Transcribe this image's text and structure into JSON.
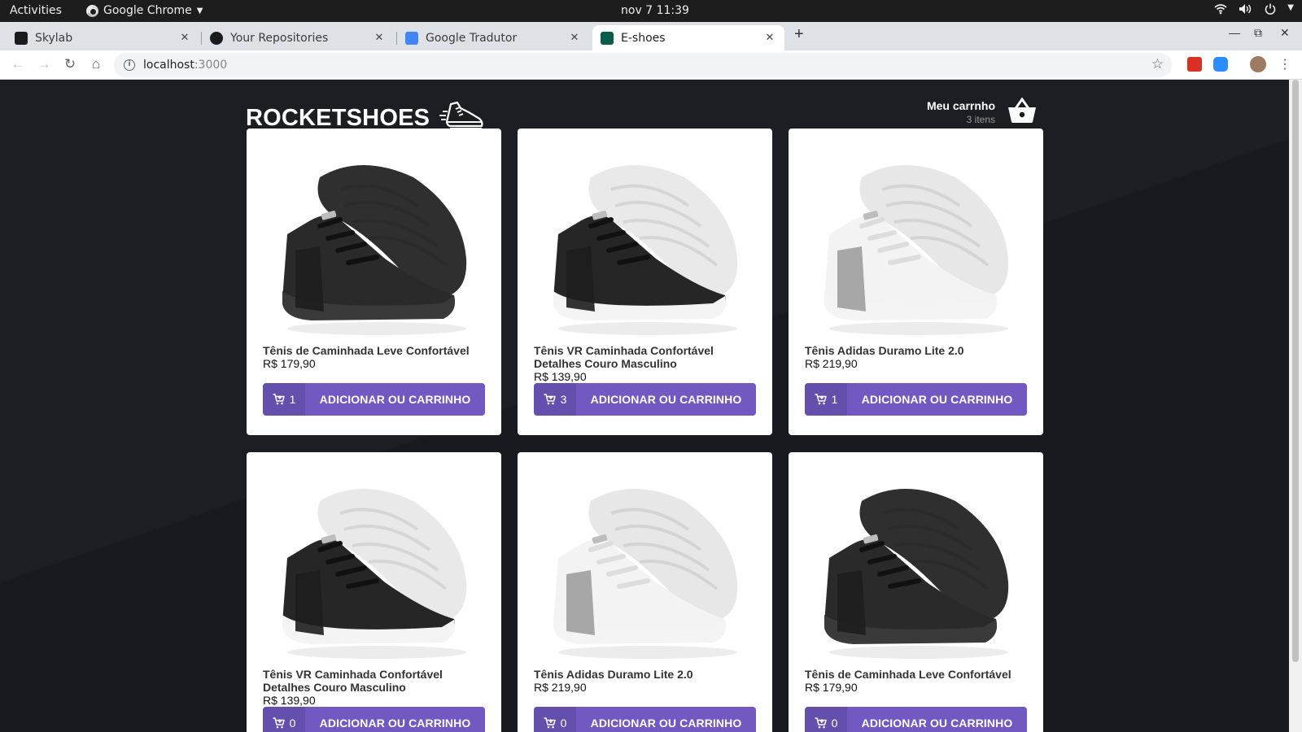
{
  "os": {
    "activities": "Activities",
    "app_name": "Google Chrome",
    "clock": "nov 7  11:39"
  },
  "browser": {
    "tabs": [
      {
        "title": "Skylab",
        "icon": "skylab-icon",
        "active": false
      },
      {
        "title": "Your Repositories",
        "icon": "github-icon",
        "active": false
      },
      {
        "title": "Google Tradutor",
        "icon": "google-translate-icon",
        "active": false
      },
      {
        "title": "E-shoes",
        "icon": "react-icon",
        "active": true
      }
    ],
    "url_host": "localhost",
    "url_port": ":3000"
  },
  "header": {
    "logo_text": "ROCKETSHOES",
    "cart_label": "Meu carrnho",
    "cart_count": "3 itens"
  },
  "products": [
    {
      "name": "Tênis de Caminhada Leve Confortável",
      "price": "R$ 179,90",
      "qty": "1",
      "button": "ADICIONAR OU CARRINHO",
      "shoe": "black"
    },
    {
      "name": "Tênis VR Caminhada Confortável Detalhes Couro Masculino",
      "price": "R$ 139,90",
      "qty": "3",
      "button": "ADICIONAR OU CARRINHO",
      "shoe": "black-white"
    },
    {
      "name": "Tênis Adidas Duramo Lite 2.0",
      "price": "R$ 219,90",
      "qty": "1",
      "button": "ADICIONAR OU CARRINHO",
      "shoe": "white-grey"
    },
    {
      "name": "Tênis VR Caminhada Confortável Detalhes Couro Masculino",
      "price": "R$ 139,90",
      "qty": "0",
      "button": "ADICIONAR OU CARRINHO",
      "shoe": "black-white"
    },
    {
      "name": "Tênis Adidas Duramo Lite 2.0",
      "price": "R$ 219,90",
      "qty": "0",
      "button": "ADICIONAR OU CARRINHO",
      "shoe": "white-grey"
    },
    {
      "name": "Tênis de Caminhada Leve Confortável",
      "price": "R$ 179,90",
      "qty": "0",
      "button": "ADICIONAR OU CARRINHO",
      "shoe": "black"
    }
  ],
  "colors": {
    "accent": "#7159c1",
    "background": "#191920"
  }
}
